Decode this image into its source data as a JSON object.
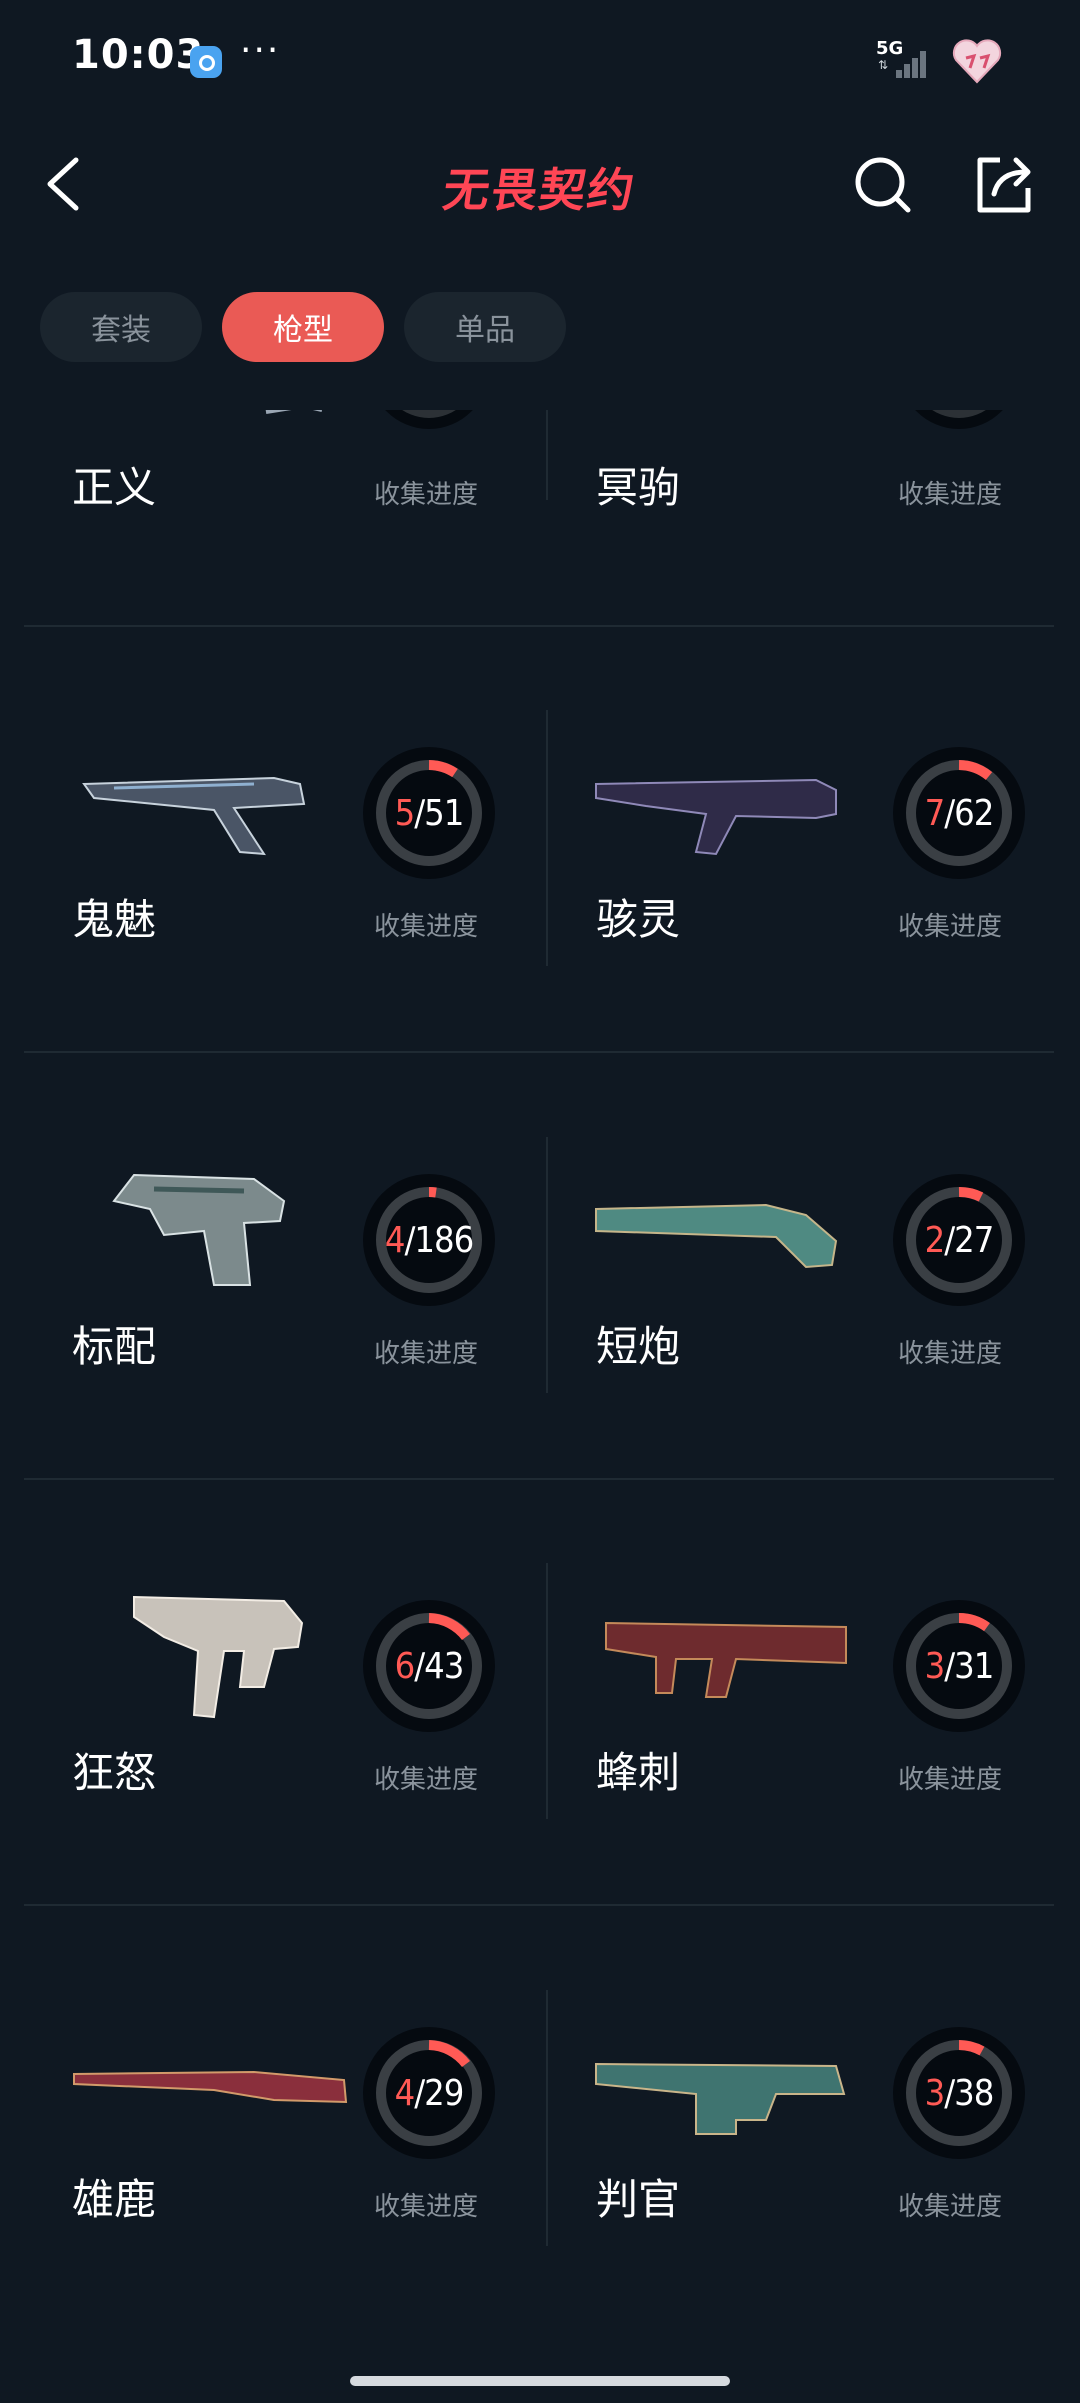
{
  "status_bar": {
    "time": "10:03",
    "more": "···",
    "network": "5G",
    "network_arrows": "⇅"
  },
  "header": {
    "title": "无畏契约",
    "title_color": "#ff4655",
    "icons": [
      "back-arrow-icon",
      "search-icon",
      "share-icon"
    ]
  },
  "tabs": [
    {
      "label": "套装",
      "active": false
    },
    {
      "label": "枪型",
      "active": true
    },
    {
      "label": "单品",
      "active": false
    }
  ],
  "progress_label": "收集进度",
  "weapons": [
    {
      "name": "正义",
      "collected": null,
      "total": null
    },
    {
      "name": "冥驹",
      "collected": null,
      "total": null
    },
    {
      "name": "鬼魅",
      "collected": "5",
      "total": "51"
    },
    {
      "name": "骇灵",
      "collected": "7",
      "total": "62"
    },
    {
      "name": "标配",
      "collected": "4",
      "total": "186"
    },
    {
      "name": "短炮",
      "collected": "2",
      "total": "27"
    },
    {
      "name": "狂怒",
      "collected": "6",
      "total": "43"
    },
    {
      "name": "蜂刺",
      "collected": "3",
      "total": "31"
    },
    {
      "name": "雄鹿",
      "collected": "4",
      "total": "29"
    },
    {
      "name": "判官",
      "collected": "3",
      "total": "38"
    }
  ],
  "colors": {
    "background": "#0f1822",
    "accent": "#ea5a55",
    "muted_text": "#8a939c"
  }
}
